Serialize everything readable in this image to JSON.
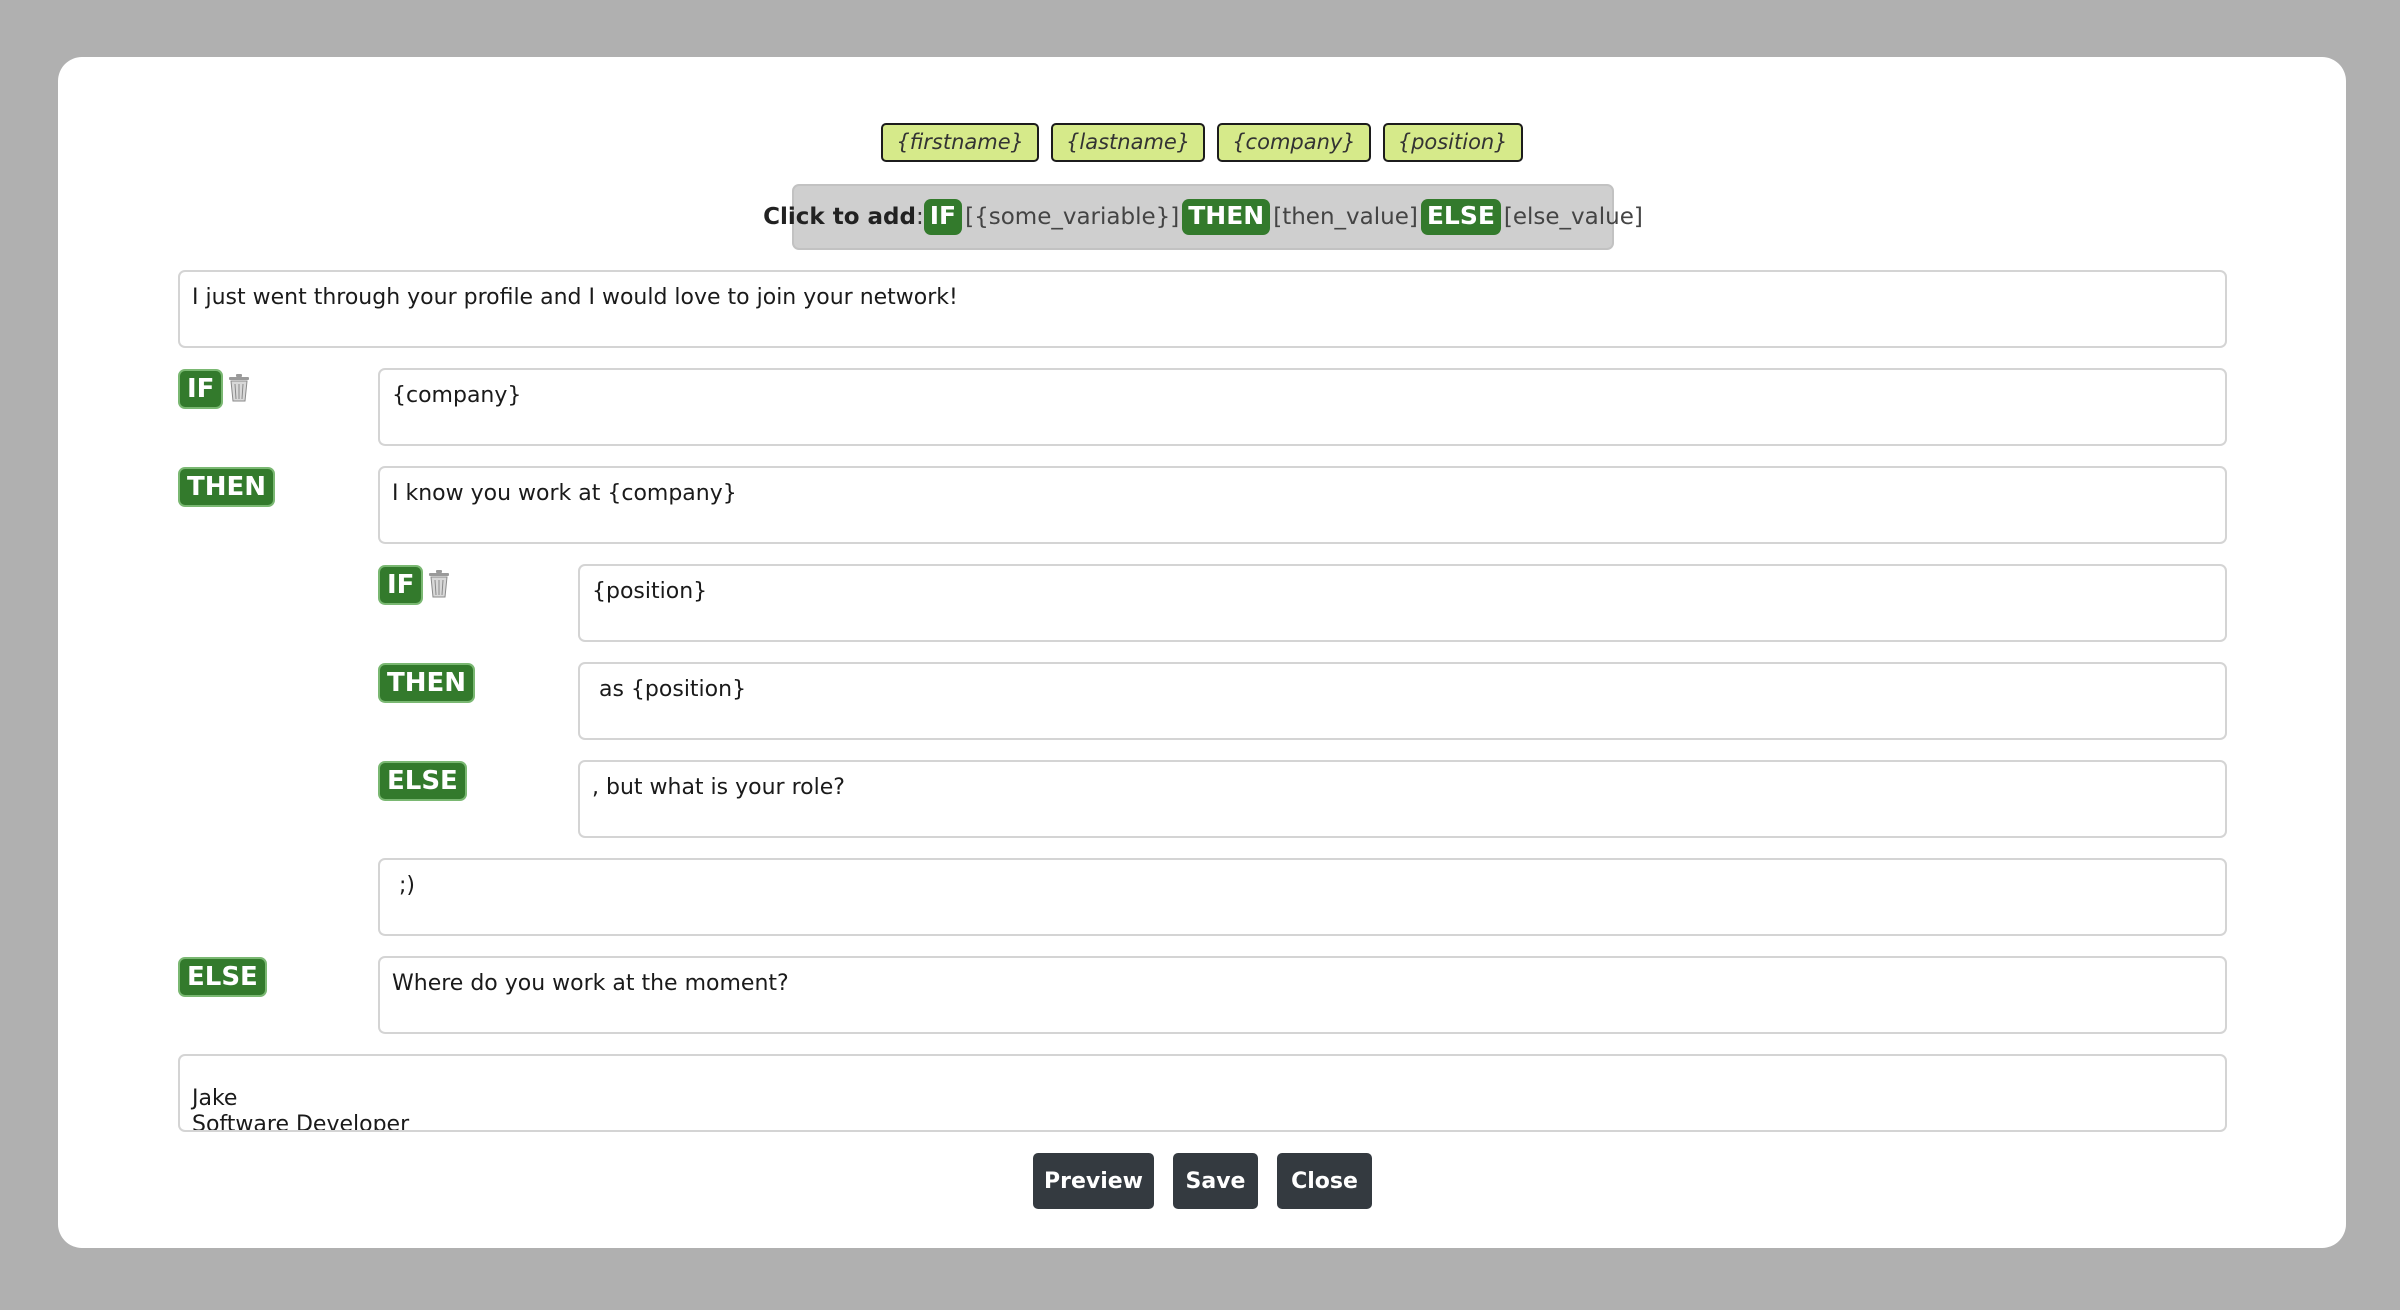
{
  "variables": [
    "{firstname}",
    "{lastname}",
    "{company}",
    "{position}"
  ],
  "add_bar": {
    "lead": "Click to add",
    "colon": ":",
    "if": "IF",
    "if_ph": "[{some_variable}]",
    "then": "THEN",
    "then_ph": "[then_value]",
    "else": "ELSE",
    "else_ph": "[else_value]"
  },
  "labels": {
    "if": "IF",
    "then": "THEN",
    "else": "ELSE"
  },
  "blocks": {
    "intro": "I just went through your profile and I would love to join your network!",
    "outer_if": "{company}",
    "outer_then": "I know you work at {company}",
    "inner_if": "{position}",
    "inner_then": " as {position}",
    "inner_else": ", but what is your role?",
    "after_inner": " ;)",
    "outer_else": "Where do you work at the moment?",
    "signature": "\nJake\nSoftware Developer"
  },
  "buttons": {
    "preview": "Preview",
    "save": "Save",
    "close": "Close"
  },
  "colors": {
    "keyword": "#337a2c",
    "chip": "#d6ea8a",
    "button": "#343a40"
  },
  "icons": {
    "delete": "trash-icon"
  }
}
